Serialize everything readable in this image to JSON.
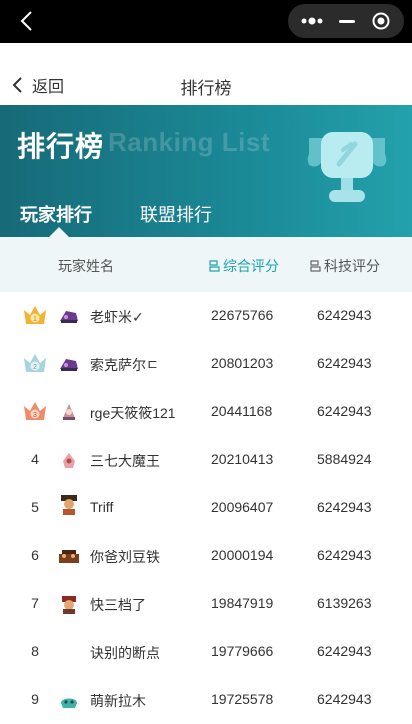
{
  "nav": {
    "back_label": "返回",
    "title": "排行榜"
  },
  "banner": {
    "title": "排行榜",
    "subtitle": "Ranking List"
  },
  "tabs": [
    {
      "label": "玩家排行",
      "active": true
    },
    {
      "label": "联盟排行",
      "active": false
    }
  ],
  "table": {
    "headers": {
      "name": "玩家姓名",
      "score": "综合评分",
      "tech": "科技评分"
    },
    "rows": [
      {
        "rank": "1",
        "name": "老虾米✓",
        "score": "22675766",
        "tech": "6242943",
        "badge": "gold"
      },
      {
        "rank": "2",
        "name": "索克萨尔ㄷ",
        "score": "20801203",
        "tech": "6242943",
        "badge": "silver"
      },
      {
        "rank": "3",
        "name": "rge天筱筱121",
        "score": "20441168",
        "tech": "6242943",
        "badge": "bronze"
      },
      {
        "rank": "4",
        "name": "三七大魔王",
        "score": "20210413",
        "tech": "5884924",
        "badge": ""
      },
      {
        "rank": "5",
        "name": "Triff",
        "score": "20096407",
        "tech": "6242943",
        "badge": ""
      },
      {
        "rank": "6",
        "name": "你爸刘豆铁",
        "score": "20000194",
        "tech": "6242943",
        "badge": ""
      },
      {
        "rank": "7",
        "name": "快三档了",
        "score": "19847919",
        "tech": "6139263",
        "badge": ""
      },
      {
        "rank": "8",
        "name": "诀别的断点",
        "score": "19779666",
        "tech": "6242943",
        "badge": ""
      },
      {
        "rank": "9",
        "name": "萌新拉木",
        "score": "19725578",
        "tech": "6242943",
        "badge": ""
      }
    ]
  },
  "colors": {
    "accent": "#1ba3ad",
    "banner_dark": "#176a78",
    "gold": "#f2b233",
    "silver": "#a9d3dd",
    "bronze": "#ee8c6a"
  },
  "icons": {
    "back": "chevron-left-icon",
    "trophy": "trophy-icon",
    "sort": "sort-icon"
  }
}
